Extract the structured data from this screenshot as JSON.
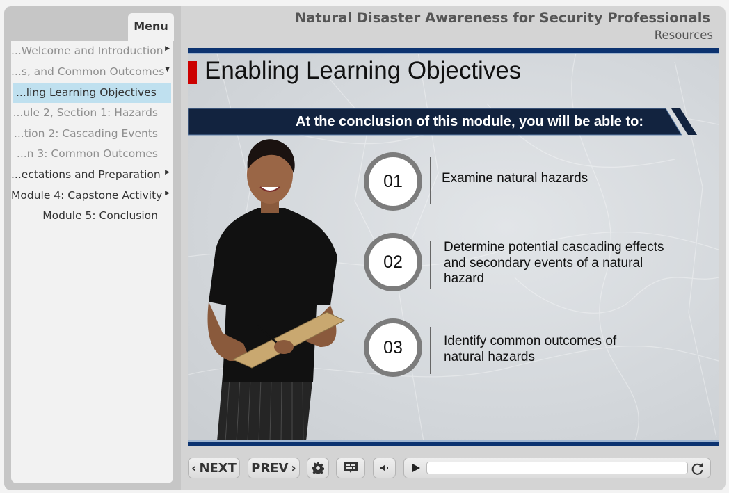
{
  "header": {
    "title": "Natural Disaster Awareness for Security Professionals",
    "resources_label": "Resources"
  },
  "sidebar": {
    "menu_label": "Menu",
    "items": [
      {
        "label": "...Welcome and Introduction",
        "state": "dim",
        "icon": "caret-right-icon"
      },
      {
        "label": "...s, and Common Outcomes",
        "state": "dim",
        "icon": "caret-down-icon"
      },
      {
        "label": "...ling Learning Objectives",
        "state": "active",
        "icon": ""
      },
      {
        "label": "...ule 2, Section 1: Hazards",
        "state": "dim",
        "icon": ""
      },
      {
        "label": "...tion 2: Cascading Events",
        "state": "dim",
        "icon": ""
      },
      {
        "label": "...n 3: Common Outcomes",
        "state": "dim",
        "icon": ""
      },
      {
        "label": "...ectations and Preparation",
        "state": "dark",
        "icon": "caret-right-icon"
      },
      {
        "label": "Module 4: Capstone Activity",
        "state": "dark",
        "icon": "caret-right-icon"
      },
      {
        "label": "Module 5: Conclusion",
        "state": "dark",
        "icon": ""
      }
    ]
  },
  "slide": {
    "title": "Enabling Learning Objectives",
    "banner": "At the conclusion of this module, you will be able to:",
    "objectives": [
      {
        "number": "01",
        "text": "Examine natural hazards"
      },
      {
        "number": "02",
        "text": "Determine potential cascading effects and secondary events of a natural hazard"
      },
      {
        "number": "03",
        "text": "Identify common outcomes of natural hazards"
      }
    ],
    "colors": {
      "accent_red": "#cc0000",
      "navy": "#0c3370",
      "banner_navy": "#12233f",
      "ring_gray": "#7c7c7c"
    }
  },
  "controls": {
    "next_label": "NEXT",
    "prev_label": "PREV",
    "settings_icon": "gear-icon",
    "captions_icon": "captions-icon",
    "volume_icon": "speaker-icon",
    "play_icon": "play-icon",
    "replay_icon": "replay-icon",
    "progress": 0
  }
}
